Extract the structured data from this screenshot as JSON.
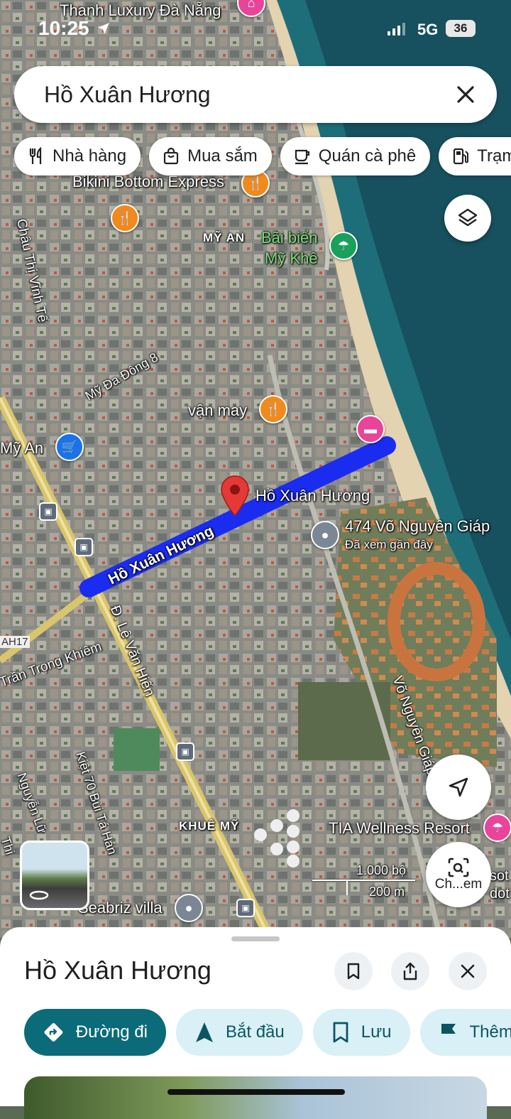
{
  "status_bar": {
    "time": "10:25",
    "network": "5G",
    "battery": "36"
  },
  "search": {
    "query": "Hồ Xuân Hương"
  },
  "chips": [
    {
      "label": "Nhà hàng",
      "icon": "fork-knife-icon"
    },
    {
      "label": "Mua sắm",
      "icon": "shopping-bag-icon"
    },
    {
      "label": "Quán cà phê",
      "icon": "coffee-cup-icon"
    },
    {
      "label": "Trạm",
      "icon": "gas-station-icon"
    }
  ],
  "map": {
    "labels": {
      "thanh_luxury": "Thanh Luxury Đà Nẵng",
      "bikini_bottom": "Bikini Bottom Express",
      "my_an_area": "MỸ AN",
      "bai_bien_1": "Bãi biển",
      "bai_bien_2": "Mỹ Khê",
      "chau_thi_vinh_te": "Châu Thị Vĩnh Tế",
      "my_da_dong": "Mỹ Đa Đông 8",
      "van_may": "vận may",
      "my_an_store": "Mỹ An",
      "pin_label": "Hồ Xuân Hương",
      "road_label": "Hồ Xuân Hương",
      "address": "474 Võ Nguyên Giáp",
      "address_sub": "Đã xem gần đây",
      "le_van_hien": "Đ. Lê Văn Hiến",
      "ah17": "AH17",
      "tran_trong_khiem": "Trần Trọng Khiêm",
      "vo_nguyen_giap": "Võ Nguyên Giáp",
      "nguyen_lu": "Nguyễn Lữ",
      "kiet_70": "Kiệt 70 Bùi Tá Hán",
      "khue_my": "KHUÊ MỸ",
      "tia_wellness": "TIA Wellness Resort",
      "seabriz": "Seabriz villa",
      "scale_ft": "1.000 bộ",
      "scale_m": "200 m",
      "lens_label": "Ch...em",
      "thi": "Thi",
      "sot": "sot",
      "dot": "dot"
    }
  },
  "sheet": {
    "title": "Hồ Xuân Hương",
    "actions": [
      {
        "label": "Đường đi",
        "icon": "directions-icon"
      },
      {
        "label": "Bắt đầu",
        "icon": "navigation-arrow-icon"
      },
      {
        "label": "Lưu",
        "icon": "bookmark-icon"
      },
      {
        "label": "Thêm",
        "icon": "flag-icon"
      }
    ]
  },
  "colors": {
    "route": "#1a2cf0",
    "primary_action": "#0b6b78",
    "secondary_action": "#d8f0f6",
    "pin": "#e53935"
  }
}
